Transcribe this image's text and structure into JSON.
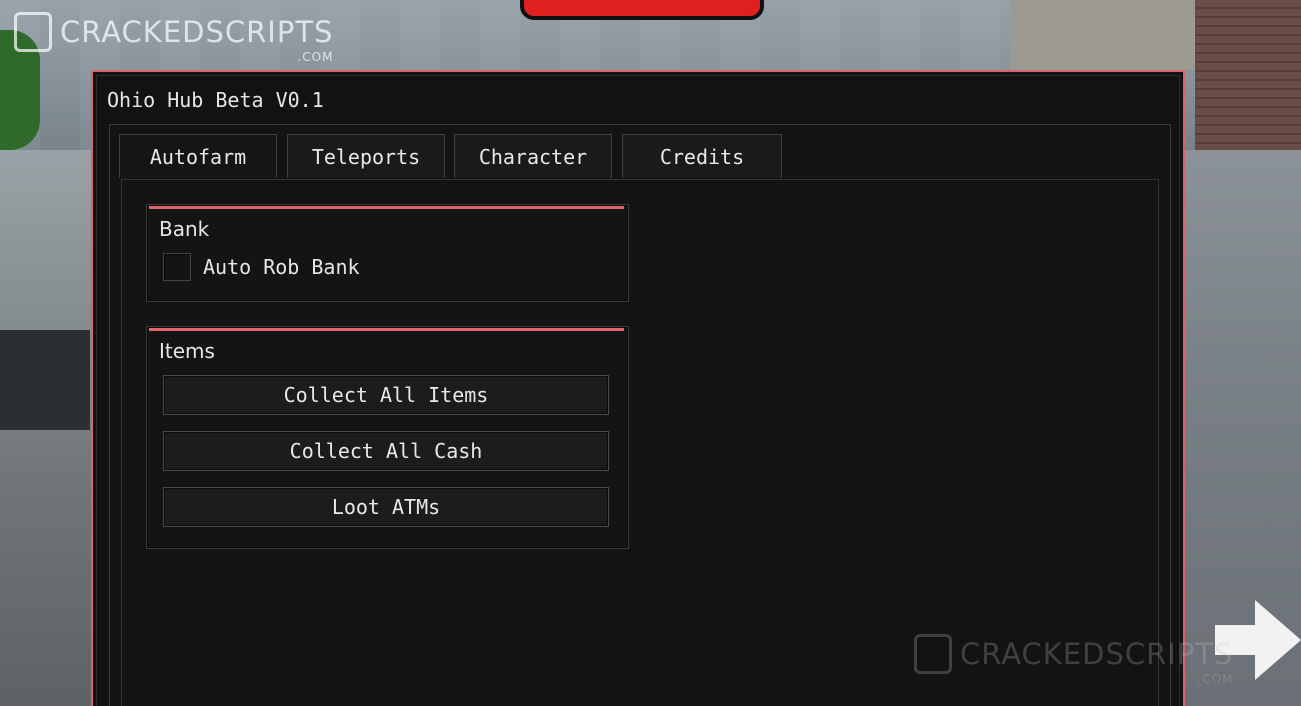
{
  "watermark": {
    "brand": "CRACKEDSCRIPTS",
    "domain": ".COM"
  },
  "window": {
    "title": "Ohio Hub Beta V0.1",
    "accent_color": "#e0676f"
  },
  "tabs": [
    {
      "label": "Autofarm",
      "active": true
    },
    {
      "label": "Teleports",
      "active": false
    },
    {
      "label": "Character",
      "active": false
    },
    {
      "label": "Credits",
      "active": false
    }
  ],
  "sections": {
    "bank": {
      "title": "Bank",
      "toggle_label": "Auto Rob Bank",
      "toggle_checked": false
    },
    "items": {
      "title": "Items",
      "buttons": [
        "Collect All Items",
        "Collect All Cash",
        "Loot ATMs"
      ]
    }
  }
}
